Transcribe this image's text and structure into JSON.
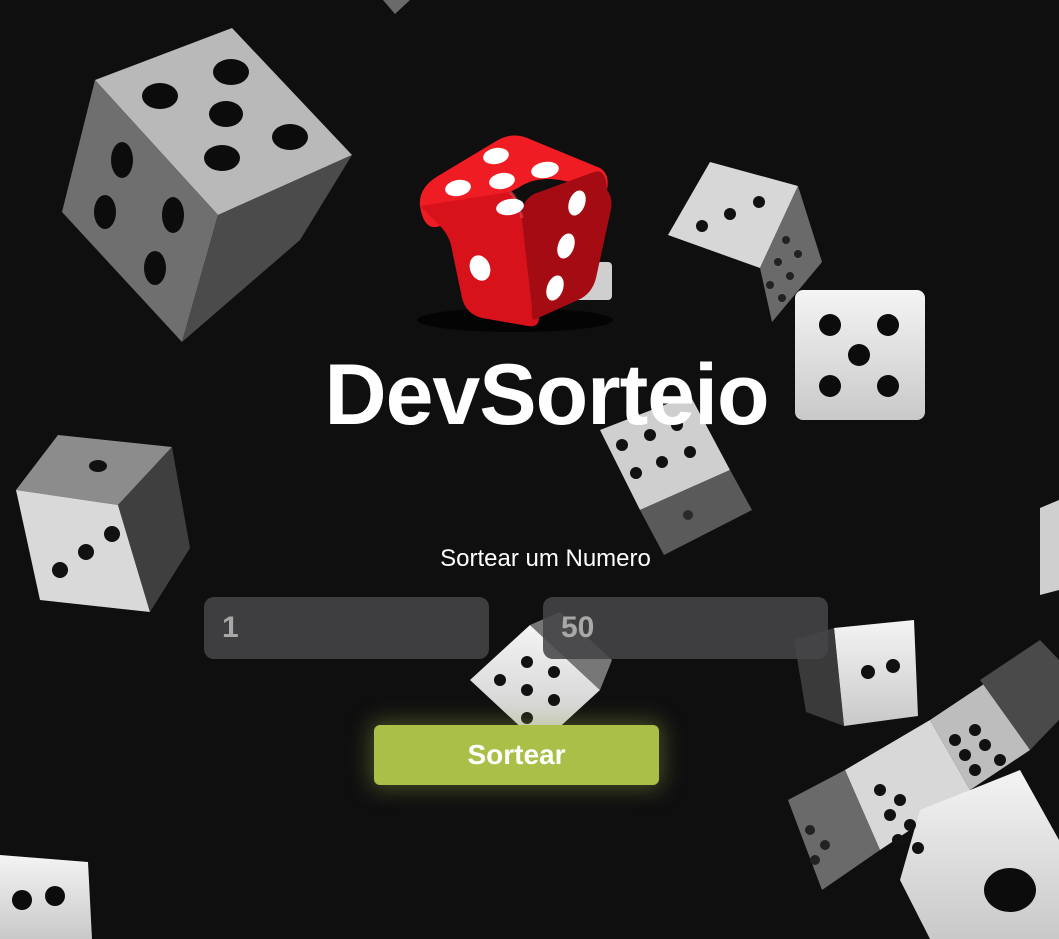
{
  "app": {
    "title": "DevSorteio",
    "logo_icon": "red-dice-icon"
  },
  "form": {
    "label": "Sortear um Numero",
    "min_value": "1",
    "max_value": "50",
    "submit_label": "Sortear"
  },
  "colors": {
    "background": "#0f0f10",
    "accent": "#a9bf47",
    "logo_red": "#e3131b",
    "input_bg": "#464648"
  }
}
